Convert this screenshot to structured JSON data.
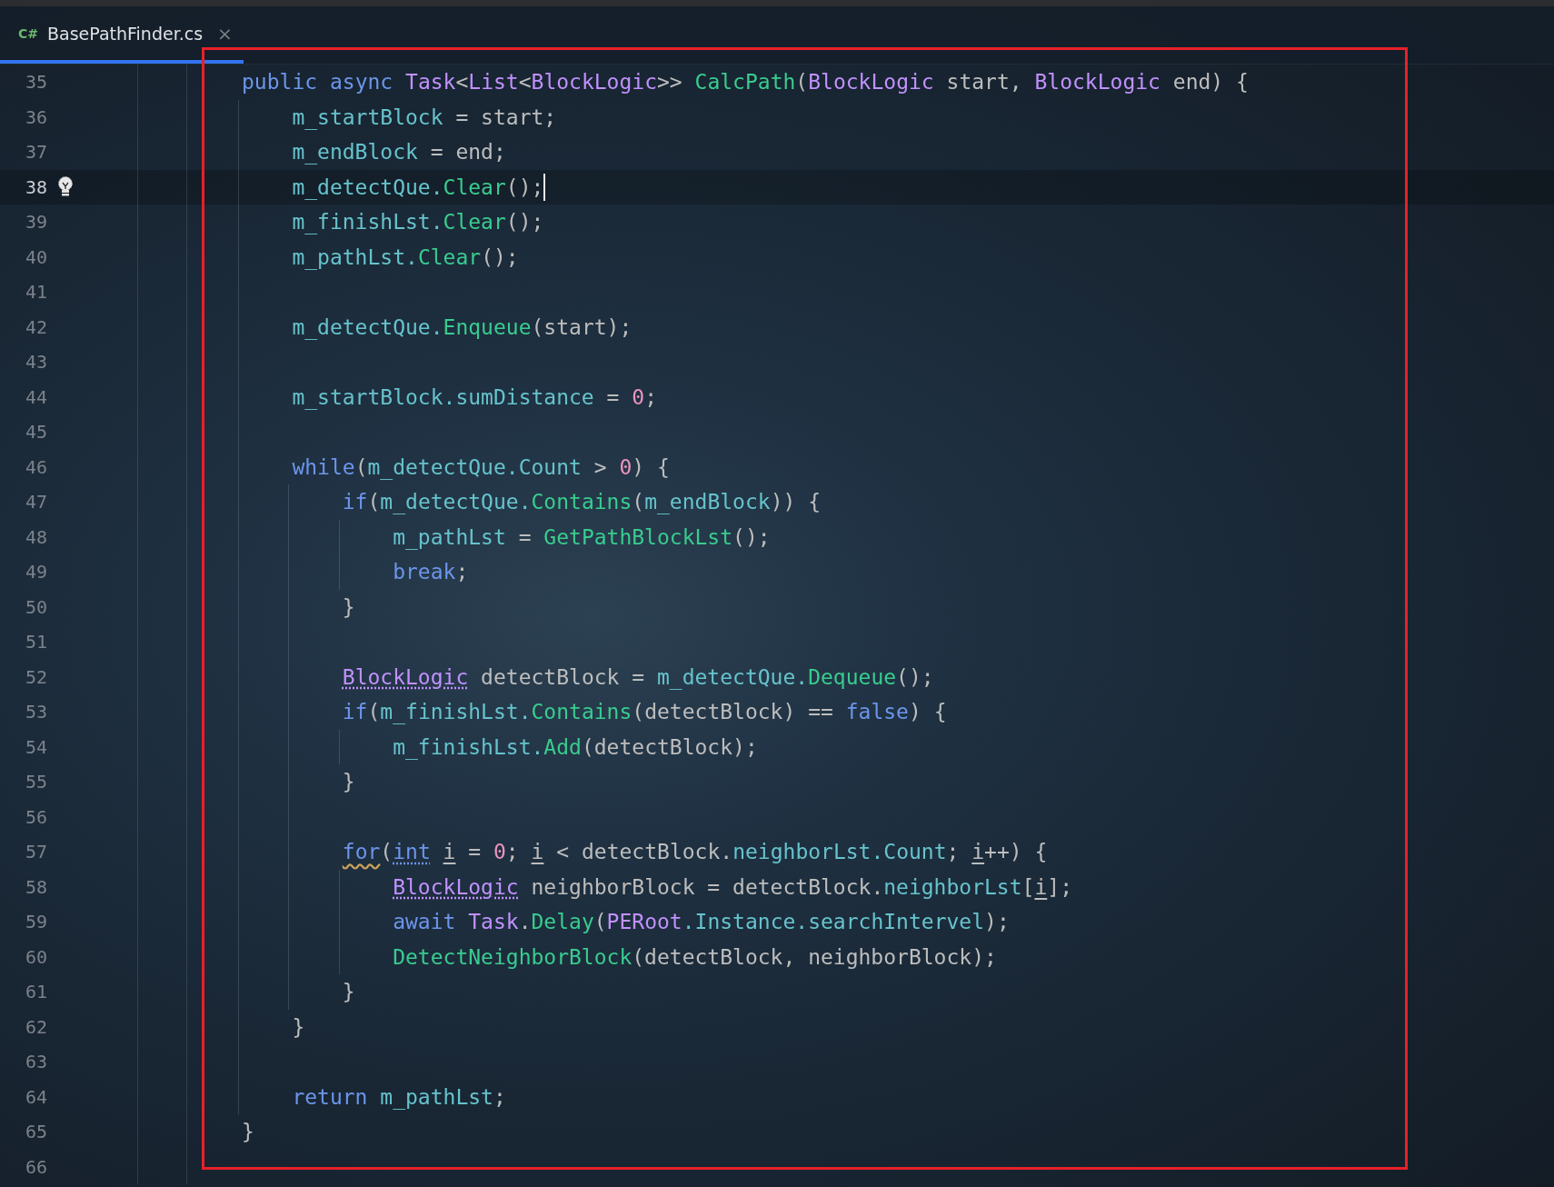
{
  "tab": {
    "language": "C#",
    "title": "BasePathFinder.cs",
    "close": "×",
    "selected": true
  },
  "lines": [
    {
      "number": "35",
      "current": false,
      "tokens": [
        {
          "kind": "kw",
          "text": "public"
        },
        {
          "kind": "kw",
          "text": " async "
        },
        {
          "kind": "type",
          "text": "Task"
        },
        {
          "kind": "plain",
          "text": "<"
        },
        {
          "kind": "type",
          "text": "List"
        },
        {
          "kind": "plain",
          "text": "<"
        },
        {
          "kind": "type",
          "text": "BlockLogic"
        },
        {
          "kind": "plain",
          "text": ">> "
        },
        {
          "kind": "method",
          "text": "CalcPath"
        },
        {
          "kind": "plain",
          "text": "("
        },
        {
          "kind": "type",
          "text": "BlockLogic"
        },
        {
          "kind": "plain",
          "text": " start, "
        },
        {
          "kind": "type",
          "text": "BlockLogic"
        },
        {
          "kind": "plain",
          "text": " end) {"
        }
      ]
    },
    {
      "number": "36",
      "current": false,
      "tokens": [
        {
          "kind": "field",
          "text": "    m_startBlock"
        },
        {
          "kind": "plain",
          "text": " = start;"
        }
      ]
    },
    {
      "number": "37",
      "current": false,
      "tokens": [
        {
          "kind": "field",
          "text": "    m_endBlock"
        },
        {
          "kind": "plain",
          "text": " = end;"
        }
      ]
    },
    {
      "number": "38",
      "current": true,
      "tokens": [
        {
          "kind": "field",
          "text": "    m_detectQue."
        },
        {
          "kind": "method",
          "text": "Clear"
        },
        {
          "kind": "plain",
          "text": "();"
        }
      ]
    },
    {
      "number": "39",
      "current": false,
      "tokens": [
        {
          "kind": "field",
          "text": "    m_finishLst."
        },
        {
          "kind": "method",
          "text": "Clear"
        },
        {
          "kind": "plain",
          "text": "();"
        }
      ]
    },
    {
      "number": "40",
      "current": false,
      "tokens": [
        {
          "kind": "field",
          "text": "    m_pathLst."
        },
        {
          "kind": "method",
          "text": "Clear"
        },
        {
          "kind": "plain",
          "text": "();"
        }
      ]
    },
    {
      "number": "41",
      "current": false
    },
    {
      "number": "42",
      "current": false,
      "tokens": [
        {
          "kind": "field",
          "text": "    m_detectQue."
        },
        {
          "kind": "method",
          "text": "Enqueue"
        },
        {
          "kind": "plain",
          "text": "(start);"
        }
      ]
    },
    {
      "number": "43",
      "current": false
    },
    {
      "number": "44",
      "current": false,
      "tokens": [
        {
          "kind": "field",
          "text": "    m_startBlock.sumDistance"
        },
        {
          "kind": "plain",
          "text": " = "
        },
        {
          "kind": "num",
          "text": "0"
        },
        {
          "kind": "plain",
          "text": ";"
        }
      ]
    },
    {
      "number": "45",
      "current": false
    },
    {
      "number": "46",
      "current": false,
      "tokens": [
        {
          "kind": "kw",
          "text": "    while"
        },
        {
          "kind": "plain",
          "text": "("
        },
        {
          "kind": "field",
          "text": "m_detectQue.Count"
        },
        {
          "kind": "plain",
          "text": " > "
        },
        {
          "kind": "num",
          "text": "0"
        },
        {
          "kind": "plain",
          "text": ") {"
        }
      ]
    },
    {
      "number": "47",
      "current": false,
      "tokens": [
        {
          "kind": "kw",
          "text": "        if"
        },
        {
          "kind": "plain",
          "text": "("
        },
        {
          "kind": "field",
          "text": "m_detectQue."
        },
        {
          "kind": "method",
          "text": "Contains"
        },
        {
          "kind": "plain",
          "text": "("
        },
        {
          "kind": "field",
          "text": "m_endBlock"
        },
        {
          "kind": "plain",
          "text": ")) {"
        }
      ]
    },
    {
      "number": "48",
      "current": false,
      "tokens": [
        {
          "kind": "field",
          "text": "            m_pathLst"
        },
        {
          "kind": "plain",
          "text": " = "
        },
        {
          "kind": "method",
          "text": "GetPathBlockLst"
        },
        {
          "kind": "plain",
          "text": "();"
        }
      ]
    },
    {
      "number": "49",
      "current": false,
      "tokens": [
        {
          "kind": "kw",
          "text": "            break"
        },
        {
          "kind": "plain",
          "text": ";"
        }
      ]
    },
    {
      "number": "50",
      "current": false,
      "tokens": [
        {
          "kind": "plain",
          "text": "        }"
        }
      ]
    },
    {
      "number": "51",
      "current": false
    },
    {
      "number": "52",
      "current": false,
      "tokens": [
        {
          "kind": "type",
          "text": "        BlockLogic",
          "dotted": true
        },
        {
          "kind": "plain",
          "text": " detectBlock = "
        },
        {
          "kind": "field",
          "text": "m_detectQue."
        },
        {
          "kind": "method",
          "text": "Dequeue"
        },
        {
          "kind": "plain",
          "text": "();"
        }
      ]
    },
    {
      "number": "53",
      "current": false,
      "tokens": [
        {
          "kind": "kw",
          "text": "        if"
        },
        {
          "kind": "plain",
          "text": "("
        },
        {
          "kind": "field",
          "text": "m_finishLst."
        },
        {
          "kind": "method",
          "text": "Contains"
        },
        {
          "kind": "plain",
          "text": "(detectBlock) == "
        },
        {
          "kind": "kw",
          "text": "false"
        },
        {
          "kind": "plain",
          "text": ") {"
        }
      ]
    },
    {
      "number": "54",
      "current": false,
      "tokens": [
        {
          "kind": "field",
          "text": "            m_finishLst."
        },
        {
          "kind": "method",
          "text": "Add"
        },
        {
          "kind": "plain",
          "text": "(detectBlock);"
        }
      ]
    },
    {
      "number": "55",
      "current": false,
      "tokens": [
        {
          "kind": "plain",
          "text": "        }"
        }
      ]
    },
    {
      "number": "56",
      "current": false
    },
    {
      "number": "57",
      "current": false,
      "tokens": [
        {
          "kind": "kw",
          "text": "        for",
          "wavy": true
        },
        {
          "kind": "plain",
          "text": "("
        },
        {
          "kind": "kw",
          "text": "int ",
          "dotted": true
        },
        {
          "kind": "plain",
          "text": "i",
          "underlined": true
        },
        {
          "kind": "plain",
          "text": " = "
        },
        {
          "kind": "num",
          "text": "0"
        },
        {
          "kind": "plain",
          "text": "; "
        },
        {
          "kind": "plain",
          "text": "i",
          "underlined": true
        },
        {
          "kind": "plain",
          "text": " < detectBlock."
        },
        {
          "kind": "field",
          "text": "neighborLst.Count"
        },
        {
          "kind": "plain",
          "text": "; "
        },
        {
          "kind": "plain",
          "text": "i",
          "underlined": true
        },
        {
          "kind": "plain",
          "text": "++) {"
        }
      ]
    },
    {
      "number": "58",
      "current": false,
      "tokens": [
        {
          "kind": "type",
          "text": "            BlockLogic",
          "dotted": true
        },
        {
          "kind": "plain",
          "text": " neighborBlock = detectBlock."
        },
        {
          "kind": "field",
          "text": "neighborLst"
        },
        {
          "kind": "plain",
          "text": "["
        },
        {
          "kind": "plain",
          "text": "i",
          "underlined": true
        },
        {
          "kind": "plain",
          "text": "];"
        }
      ]
    },
    {
      "number": "59",
      "current": false,
      "tokens": [
        {
          "kind": "kw",
          "text": "            await "
        },
        {
          "kind": "type",
          "text": "Task"
        },
        {
          "kind": "plain",
          "text": "."
        },
        {
          "kind": "method",
          "text": "Delay"
        },
        {
          "kind": "plain",
          "text": "("
        },
        {
          "kind": "type",
          "text": "PERoot"
        },
        {
          "kind": "field",
          "text": ".Instance.searchIntervel"
        },
        {
          "kind": "plain",
          "text": ");"
        }
      ]
    },
    {
      "number": "60",
      "current": false,
      "tokens": [
        {
          "kind": "method",
          "text": "            DetectNeighborBlock"
        },
        {
          "kind": "plain",
          "text": "(detectBlock, neighborBlock);"
        }
      ]
    },
    {
      "number": "61",
      "current": false,
      "tokens": [
        {
          "kind": "plain",
          "text": "        }"
        }
      ]
    },
    {
      "number": "62",
      "current": false,
      "tokens": [
        {
          "kind": "plain",
          "text": "    }"
        }
      ]
    },
    {
      "number": "63",
      "current": false
    },
    {
      "number": "64",
      "current": false,
      "tokens": [
        {
          "kind": "kw",
          "text": "    return "
        },
        {
          "kind": "field",
          "text": "m_pathLst"
        },
        {
          "kind": "plain",
          "text": ";"
        }
      ]
    },
    {
      "number": "65",
      "current": false,
      "tokens": [
        {
          "kind": "plain",
          "text": "}"
        }
      ]
    },
    {
      "number": "66",
      "current": false
    }
  ]
}
